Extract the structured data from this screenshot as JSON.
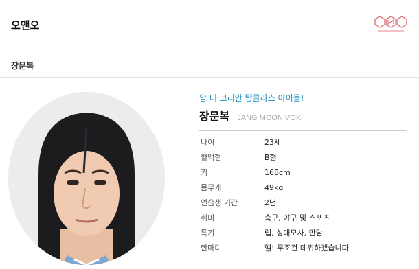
{
  "header": {
    "title": "오앤오",
    "logo_icon": "ono-hexagon-logo"
  },
  "breadcrumb": {
    "label": "장문복"
  },
  "profile": {
    "catchphrase": "암 더 코리안 탑클라스 아이돌!",
    "name_ko": "장문복",
    "name_en": "JANG MOON VOK",
    "details": [
      {
        "label": "나이",
        "value": "23세"
      },
      {
        "label": "혈액형",
        "value": "B형"
      },
      {
        "label": "키",
        "value": "168cm"
      },
      {
        "label": "몸무게",
        "value": "49kg"
      },
      {
        "label": "연습생 기간",
        "value": "2년"
      },
      {
        "label": "취미",
        "value": "축구, 야구 및 스포츠"
      },
      {
        "label": "특기",
        "value": "랩, 성대모사, 만담"
      },
      {
        "label": "한마디",
        "value": "헬! 무조건 데뷔하겠습니다"
      }
    ]
  },
  "colors": {
    "accent": "#1e8fbf",
    "logo": "#e0707a"
  }
}
